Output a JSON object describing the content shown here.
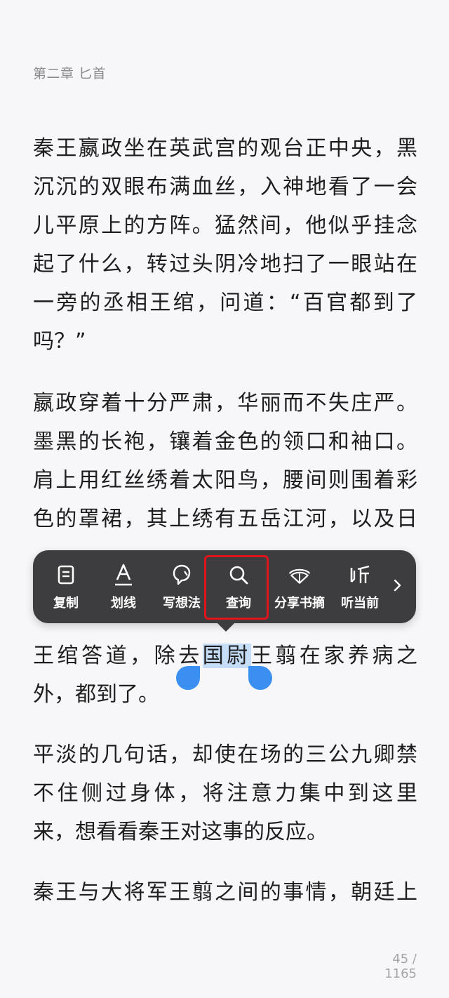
{
  "chapter": {
    "title": "第二章 匕首"
  },
  "paragraphs": {
    "p1": [
      "秦王嬴政坐在英武宫的观台正中央，黑",
      "沉沉的双眼布满血丝，入神地看了一会",
      "儿平原上的方阵。猛然间，他似乎挂念",
      "起了什么，转过头阴冷地扫了一眼站在",
      "一旁的丞相王绾，问道：“百官都到了",
      "吗？”"
    ],
    "p2": [
      "嬴政穿着十分严肃，华丽而不失庄严。",
      "墨黑的长袍，镶着金色的领口和袖口。",
      "肩上用红丝绣着太阳鸟，腰间则围着彩",
      "色的罩裙，其上绣有五岳江河，以及日"
    ],
    "p3": {
      "line1_before": "王绾答道，除去",
      "line1_selected": "国尉",
      "line1_after": "王翦在家养病之",
      "line2": "外，都到了。"
    },
    "p4": [
      "平淡的几句话，却使在场的三公九卿禁",
      "不住侧过身体，将注意力集中到这里",
      "来，想看看秦王对这事的反应。"
    ],
    "p5": [
      "秦王与大将军王翦之间的事情，朝廷上"
    ]
  },
  "toolbar": {
    "items": [
      {
        "label": "复制",
        "icon": "copy-icon"
      },
      {
        "label": "划线",
        "icon": "underline-icon"
      },
      {
        "label": "写想法",
        "icon": "thought-icon"
      },
      {
        "label": "查询",
        "icon": "search-icon"
      },
      {
        "label": "分享书摘",
        "icon": "share-icon"
      },
      {
        "label": "听当前",
        "icon": "listen-icon"
      }
    ],
    "more_icon": "chevron-right-icon"
  },
  "footer": {
    "page": "45 / 1165"
  },
  "colors": {
    "background": "#f7f7f9",
    "toolbar": "#3d3d3f",
    "selection": "#c6ddf7",
    "handle": "#3a8ff0",
    "highlight_box": "#e0141b"
  }
}
